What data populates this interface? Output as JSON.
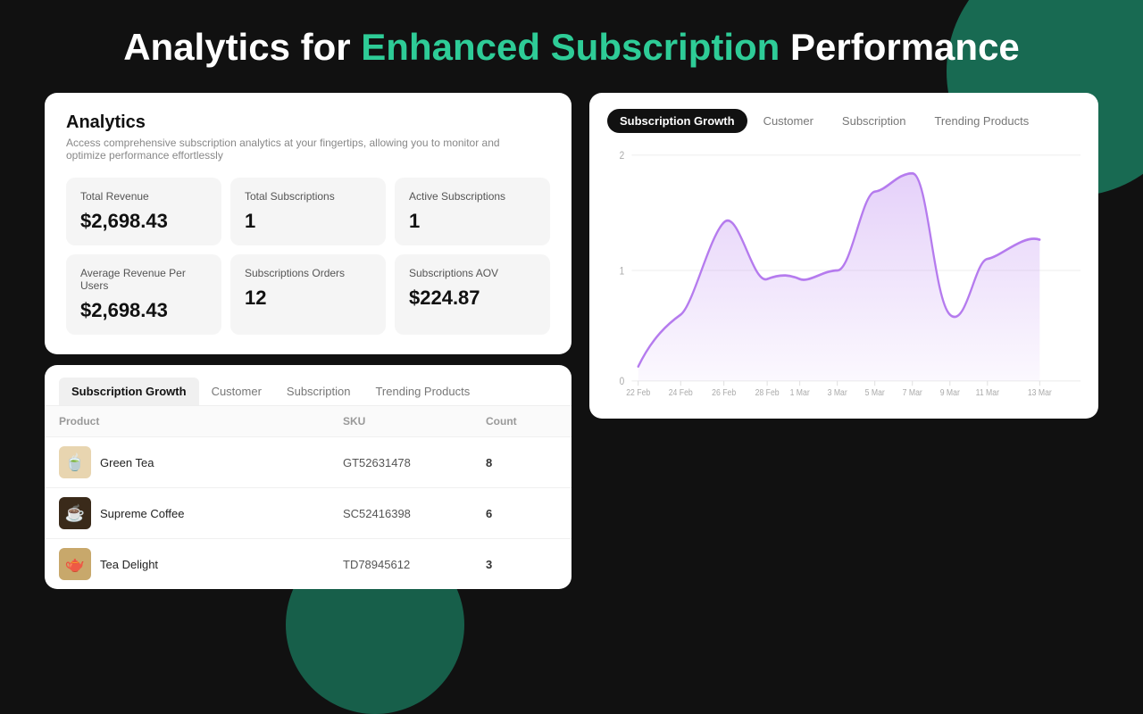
{
  "page": {
    "title_start": "Analytics for ",
    "title_highlight": "Enhanced Subscription",
    "title_end": " Performance"
  },
  "analytics": {
    "title": "Analytics",
    "description": "Access comprehensive subscription analytics at your fingertips, allowing you to monitor and optimize performance effortlessly",
    "metrics": [
      {
        "label": "Total Revenue",
        "value": "$2,698.43"
      },
      {
        "label": "Total Subscriptions",
        "value": "1"
      },
      {
        "label": "Active Subscriptions",
        "value": "1"
      },
      {
        "label": "Average Revenue Per Users",
        "value": "$2,698.43"
      },
      {
        "label": "Subscriptions Orders",
        "value": "12"
      },
      {
        "label": "Subscriptions AOV",
        "value": "$224.87"
      }
    ]
  },
  "table": {
    "tabs": [
      {
        "label": "Subscription Growth",
        "active": true
      },
      {
        "label": "Customer",
        "active": false
      },
      {
        "label": "Subscription",
        "active": false
      },
      {
        "label": "Trending Products",
        "active": false
      }
    ],
    "columns": [
      "Product",
      "SKU",
      "Count"
    ],
    "rows": [
      {
        "name": "Green Tea",
        "sku": "GT52631478",
        "count": "8",
        "thumb_type": "tea",
        "thumb_emoji": "🍵"
      },
      {
        "name": "Supreme Coffee",
        "sku": "SC52416398",
        "count": "6",
        "thumb_type": "coffee",
        "thumb_emoji": "☕"
      },
      {
        "name": "Tea Delight",
        "sku": "TD78945612",
        "count": "3",
        "thumb_type": "delight",
        "thumb_emoji": "🫖"
      }
    ]
  },
  "chart": {
    "tabs": [
      {
        "label": "Subscription Growth",
        "active": true
      },
      {
        "label": "Customer",
        "active": false
      },
      {
        "label": "Subscription",
        "active": false
      },
      {
        "label": "Trending Products",
        "active": false
      }
    ],
    "y_labels": [
      "2",
      "1",
      "0"
    ],
    "x_labels": [
      "22 Feb",
      "24 Feb",
      "26 Feb",
      "28 Feb",
      "1 Mar",
      "3 Mar",
      "5 Mar",
      "7 Mar",
      "9 Mar",
      "11 Mar",
      "13 Mar"
    ],
    "line_color": "#b57bee",
    "fill_color": "rgba(181,123,238,0.2)"
  },
  "decorative": {
    "bg_color": "#111111",
    "accent_color": "#1a7a5e",
    "highlight_color": "#2ecc97"
  }
}
